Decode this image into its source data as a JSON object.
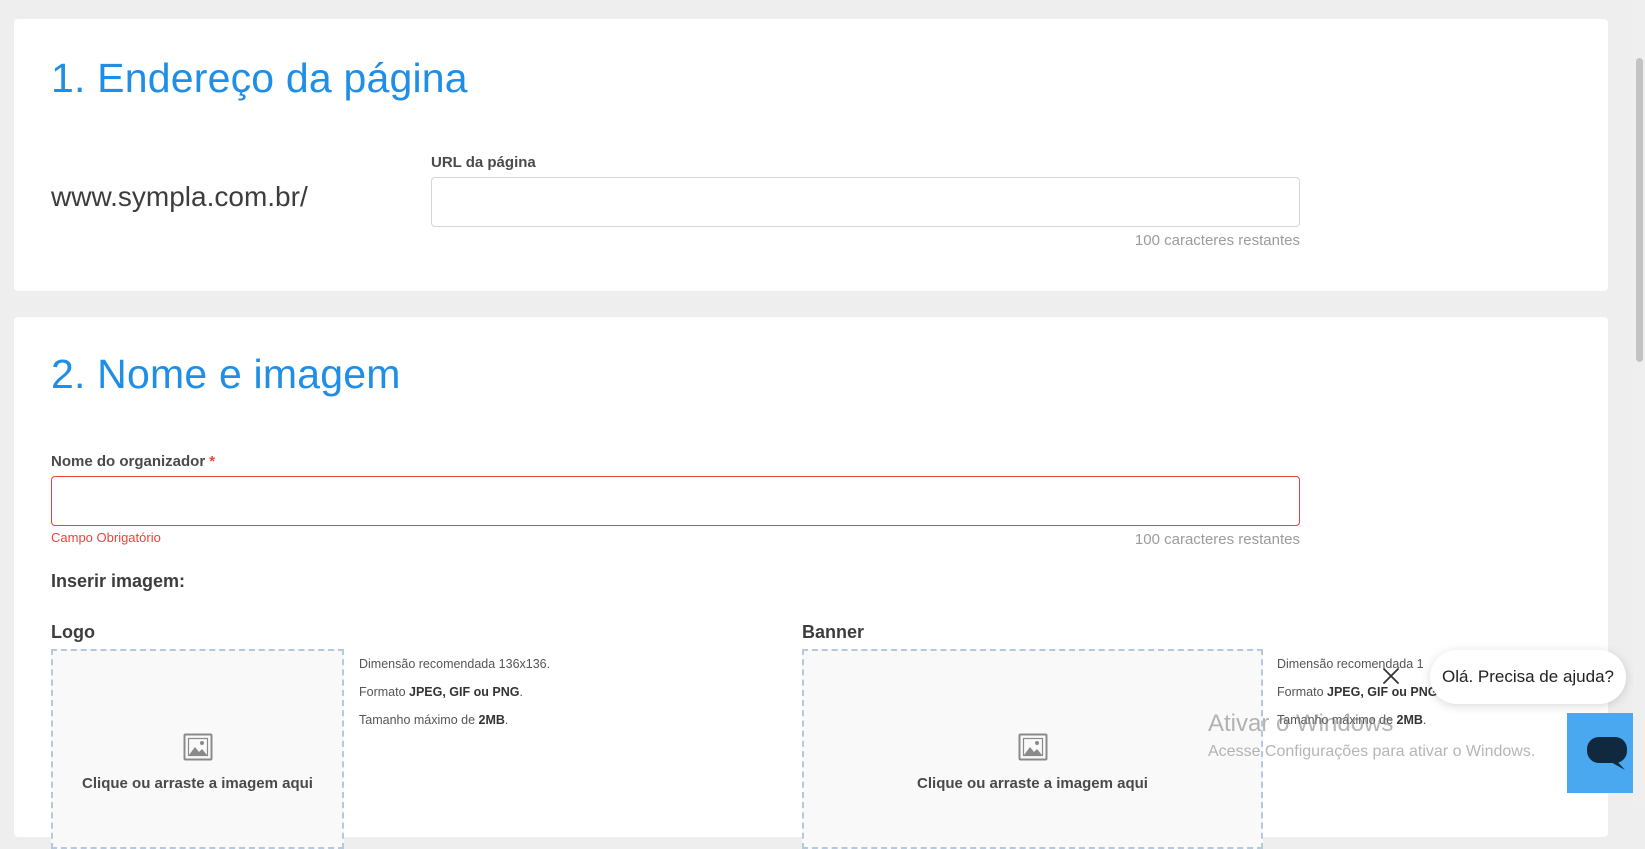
{
  "section1": {
    "title": "1. Endereço da página",
    "domain_prefix": "www.sympla.com.br/",
    "url_label": "URL da página",
    "url_value": "",
    "url_counter": "100 caracteres restantes"
  },
  "section2": {
    "title": "2. Nome e imagem",
    "organizer_label": "Nome do organizador",
    "required_mark": "*",
    "organizer_value": "",
    "organizer_error": "Campo Obrigatório",
    "organizer_counter": "100 caracteres restantes",
    "insert_image_label": "Inserir imagem:",
    "logo": {
      "label": "Logo",
      "dropzone_text": "Clique ou arraste a imagem aqui",
      "hint_dimension": "Dimensão recomendada 136x136.",
      "hint_format_prefix": "Formato ",
      "hint_format_bold": "JPEG, GIF ou PNG",
      "hint_format_suffix": ".",
      "hint_size_prefix": "Tamanho máximo de ",
      "hint_size_bold": "2MB",
      "hint_size_suffix": "."
    },
    "banner": {
      "label": "Banner",
      "dropzone_text": "Clique ou arraste a imagem aqui",
      "hint_dimension": "Dimensão recomendada 1",
      "hint_format_prefix": "Formato ",
      "hint_format_bold": "JPEG, GIF ou PNG",
      "hint_format_suffix": ".",
      "hint_size_prefix": "Tamanho máximo de ",
      "hint_size_bold": "2MB",
      "hint_size_suffix": "."
    }
  },
  "chat": {
    "bubble_text": "Olá. Precisa de ajuda?"
  },
  "windows_watermark": {
    "title": "Ativar o Windows",
    "subtitle": "Acesse Configurações para ativar o Windows."
  },
  "colors": {
    "accent": "#1e8ee6",
    "error": "#e8453c",
    "chat_launcher": "#4aa8f0"
  }
}
